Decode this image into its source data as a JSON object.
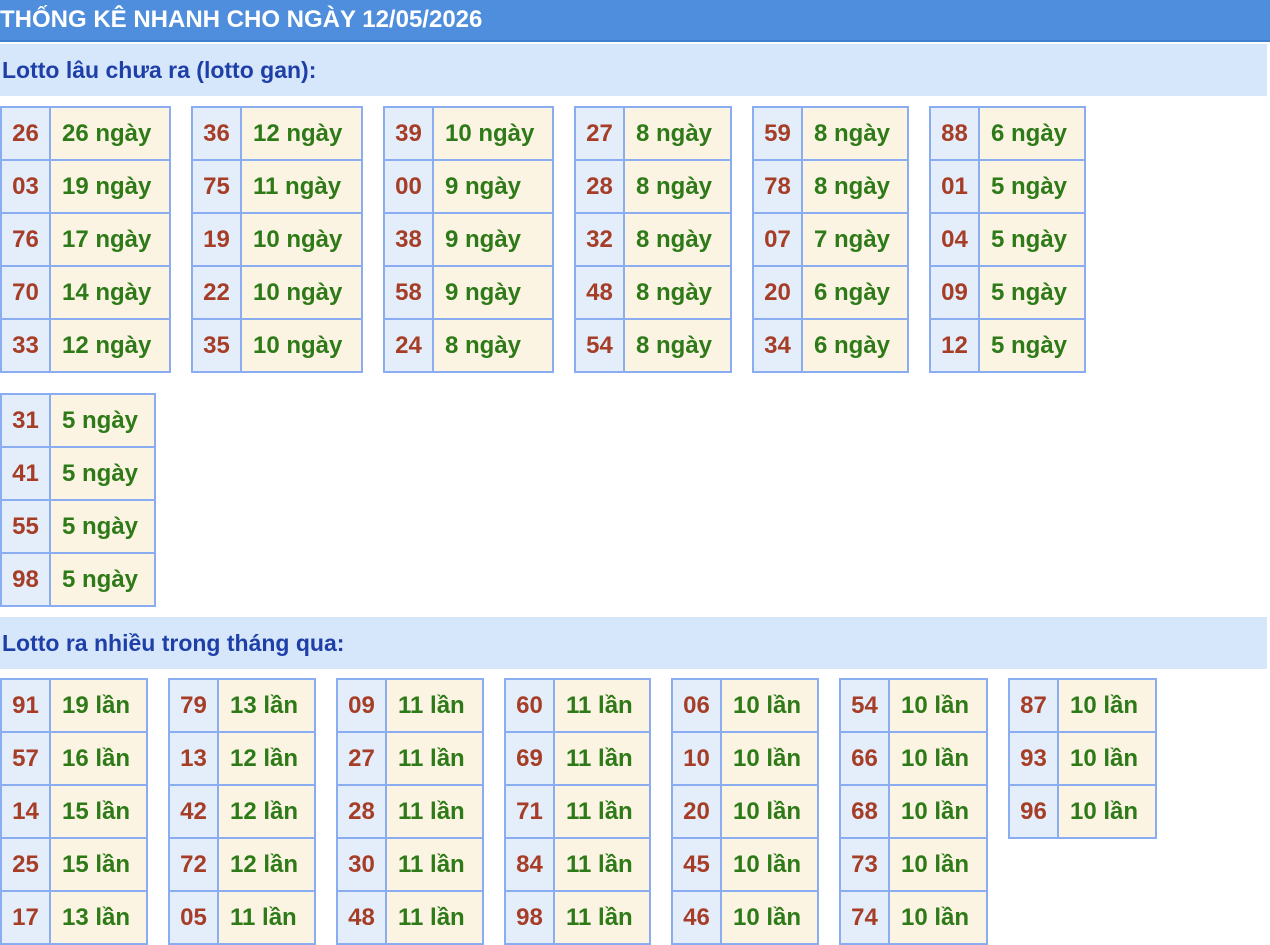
{
  "header": {
    "title": "THỐNG KÊ NHANH CHO NGÀY 12/05/2026"
  },
  "gan": {
    "title": "Lotto lâu chưa ra (lotto gan):",
    "columns": [
      [
        {
          "num": "26",
          "val": "26 ngày"
        },
        {
          "num": "03",
          "val": "19 ngày"
        },
        {
          "num": "76",
          "val": "17 ngày"
        },
        {
          "num": "70",
          "val": "14 ngày"
        },
        {
          "num": "33",
          "val": "12 ngày"
        }
      ],
      [
        {
          "num": "36",
          "val": "12 ngày"
        },
        {
          "num": "75",
          "val": "11 ngày"
        },
        {
          "num": "19",
          "val": "10 ngày"
        },
        {
          "num": "22",
          "val": "10 ngày"
        },
        {
          "num": "35",
          "val": "10 ngày"
        }
      ],
      [
        {
          "num": "39",
          "val": "10 ngày"
        },
        {
          "num": "00",
          "val": "9 ngày"
        },
        {
          "num": "38",
          "val": "9 ngày"
        },
        {
          "num": "58",
          "val": "9 ngày"
        },
        {
          "num": "24",
          "val": "8 ngày"
        }
      ],
      [
        {
          "num": "27",
          "val": "8 ngày"
        },
        {
          "num": "28",
          "val": "8 ngày"
        },
        {
          "num": "32",
          "val": "8 ngày"
        },
        {
          "num": "48",
          "val": "8 ngày"
        },
        {
          "num": "54",
          "val": "8 ngày"
        }
      ],
      [
        {
          "num": "59",
          "val": "8 ngày"
        },
        {
          "num": "78",
          "val": "8 ngày"
        },
        {
          "num": "07",
          "val": "7 ngày"
        },
        {
          "num": "20",
          "val": "6 ngày"
        },
        {
          "num": "34",
          "val": "6 ngày"
        }
      ],
      [
        {
          "num": "88",
          "val": "6 ngày"
        },
        {
          "num": "01",
          "val": "5 ngày"
        },
        {
          "num": "04",
          "val": "5 ngày"
        },
        {
          "num": "09",
          "val": "5 ngày"
        },
        {
          "num": "12",
          "val": "5 ngày"
        }
      ],
      [
        {
          "num": "31",
          "val": "5 ngày"
        },
        {
          "num": "41",
          "val": "5 ngày"
        },
        {
          "num": "55",
          "val": "5 ngày"
        },
        {
          "num": "98",
          "val": "5 ngày"
        }
      ]
    ]
  },
  "nhieu": {
    "title": "Lotto ra nhiều trong tháng qua:",
    "columns": [
      [
        {
          "num": "91",
          "val": "19 lần"
        },
        {
          "num": "57",
          "val": "16 lần"
        },
        {
          "num": "14",
          "val": "15 lần"
        },
        {
          "num": "25",
          "val": "15 lần"
        },
        {
          "num": "17",
          "val": "13 lần"
        }
      ],
      [
        {
          "num": "79",
          "val": "13 lần"
        },
        {
          "num": "13",
          "val": "12 lần"
        },
        {
          "num": "42",
          "val": "12 lần"
        },
        {
          "num": "72",
          "val": "12 lần"
        },
        {
          "num": "05",
          "val": "11 lần"
        }
      ],
      [
        {
          "num": "09",
          "val": "11 lần"
        },
        {
          "num": "27",
          "val": "11 lần"
        },
        {
          "num": "28",
          "val": "11 lần"
        },
        {
          "num": "30",
          "val": "11 lần"
        },
        {
          "num": "48",
          "val": "11 lần"
        }
      ],
      [
        {
          "num": "60",
          "val": "11 lần"
        },
        {
          "num": "69",
          "val": "11 lần"
        },
        {
          "num": "71",
          "val": "11 lần"
        },
        {
          "num": "84",
          "val": "11 lần"
        },
        {
          "num": "98",
          "val": "11 lần"
        }
      ],
      [
        {
          "num": "06",
          "val": "10 lần"
        },
        {
          "num": "10",
          "val": "10 lần"
        },
        {
          "num": "20",
          "val": "10 lần"
        },
        {
          "num": "45",
          "val": "10 lần"
        },
        {
          "num": "46",
          "val": "10 lần"
        }
      ],
      [
        {
          "num": "54",
          "val": "10 lần"
        },
        {
          "num": "66",
          "val": "10 lần"
        },
        {
          "num": "68",
          "val": "10 lần"
        },
        {
          "num": "73",
          "val": "10 lần"
        },
        {
          "num": "74",
          "val": "10 lần"
        }
      ],
      [
        {
          "num": "87",
          "val": "10 lần"
        },
        {
          "num": "93",
          "val": "10 lần"
        },
        {
          "num": "96",
          "val": "10 lần"
        }
      ]
    ]
  }
}
